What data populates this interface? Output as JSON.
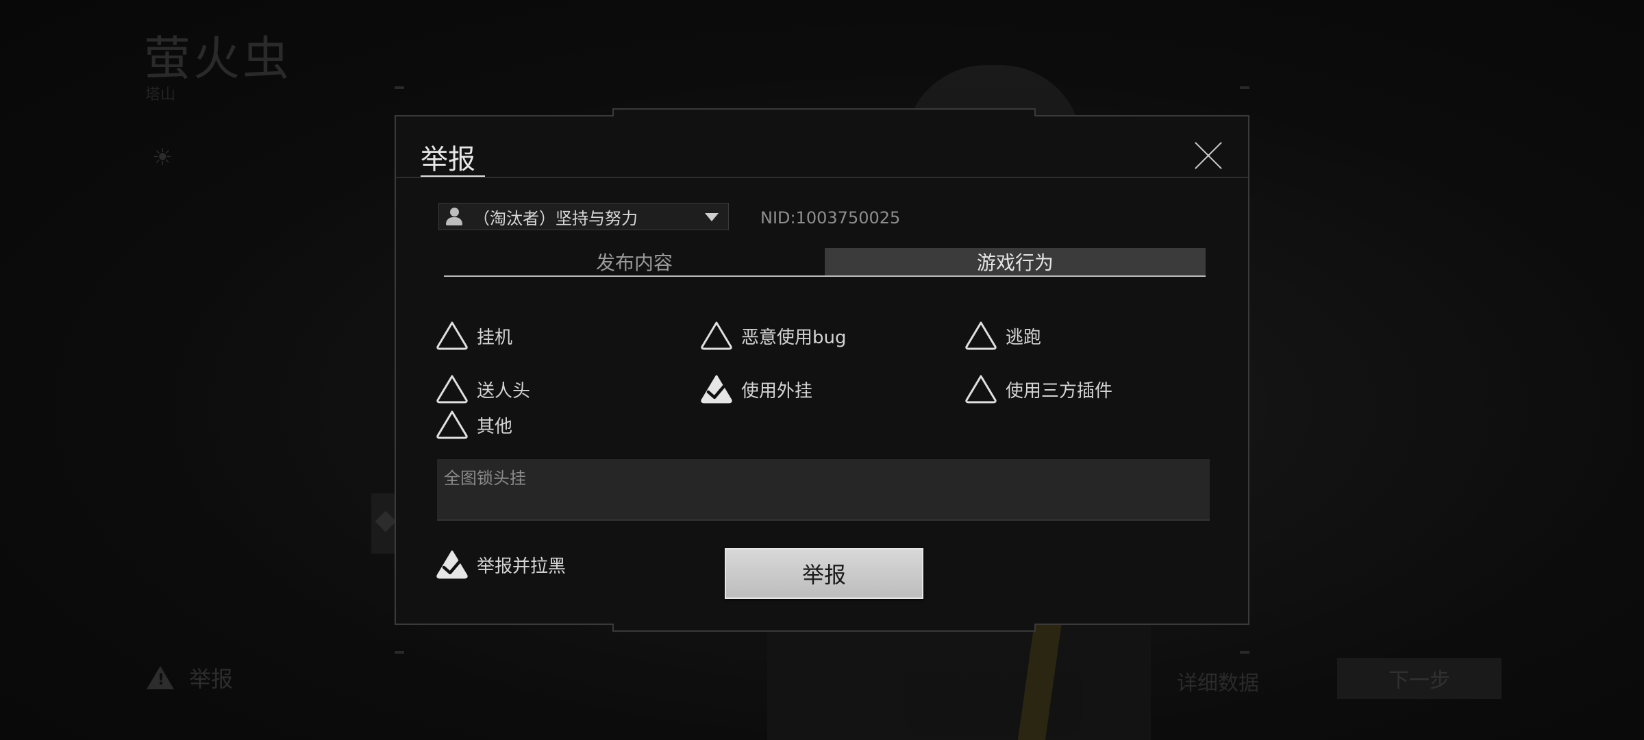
{
  "background": {
    "title": "萤火虫",
    "subtitle": "塔山",
    "report_link": "举报",
    "detail_link": "详细数据",
    "next_button": "下一步"
  },
  "dialog": {
    "title": "举报",
    "player": {
      "name": "（淘汰者）坚持与努力",
      "nid": "NID:1003750025"
    },
    "tabs": [
      {
        "label": "发布内容",
        "active": false
      },
      {
        "label": "游戏行为",
        "active": true
      }
    ],
    "options": [
      {
        "label": "挂机",
        "checked": false
      },
      {
        "label": "恶意使用bug",
        "checked": false
      },
      {
        "label": "逃跑",
        "checked": false
      },
      {
        "label": "送人头",
        "checked": false
      },
      {
        "label": "使用外挂",
        "checked": true
      },
      {
        "label": "使用三方插件",
        "checked": false
      },
      {
        "label": "其他",
        "checked": false
      }
    ],
    "note_text": "全图锁头挂",
    "block_option": {
      "label": "举报并拉黑",
      "checked": true
    },
    "submit_label": "举报"
  },
  "colors": {
    "accent": "#e6e6e6",
    "background": "#0b0b0b",
    "dialog_bg": "#111111",
    "active_tab": "#3b3b3b"
  }
}
